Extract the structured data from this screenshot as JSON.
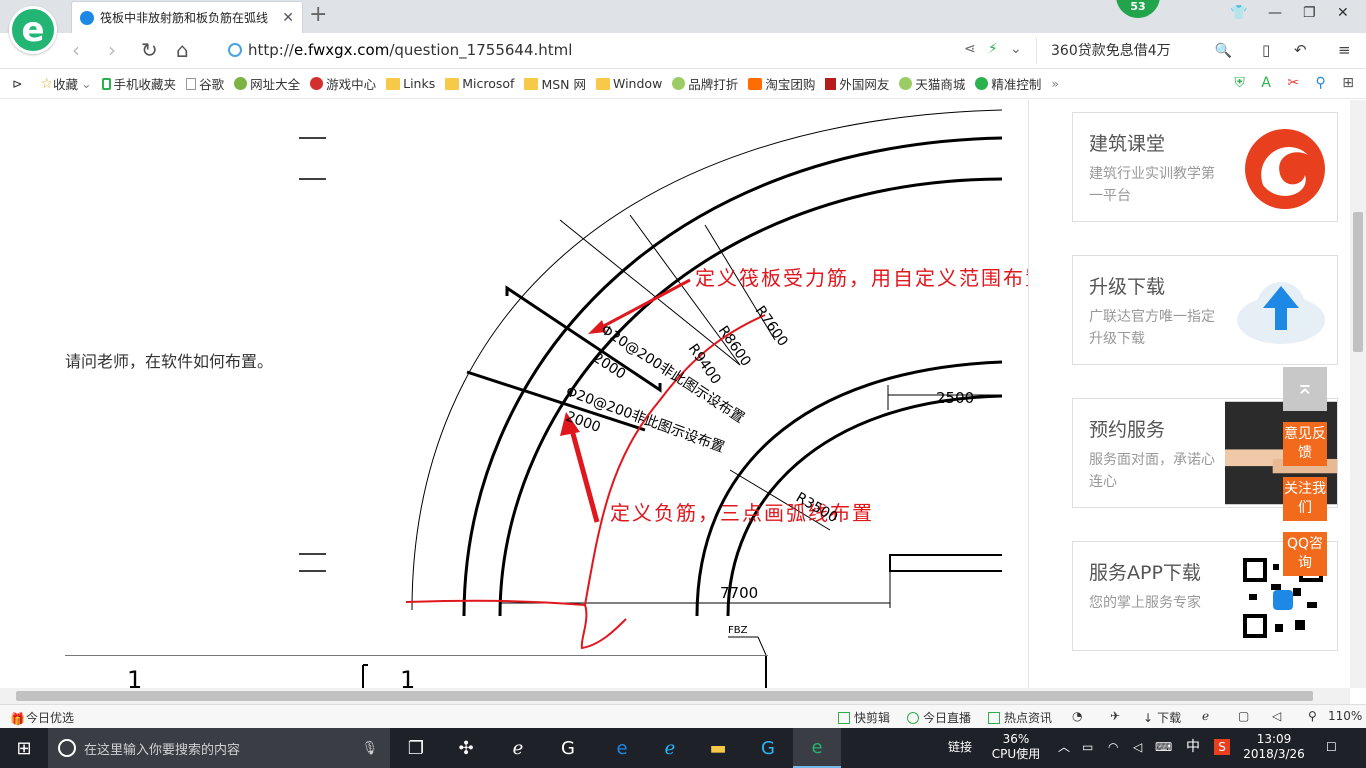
{
  "tab": {
    "title": "筏板中非放射筋和板负筋在弧线"
  },
  "notification_badge": "53",
  "address": {
    "scheme": "http://",
    "host": "e.fwxgx.com",
    "path": "/question_1755644.html"
  },
  "search": {
    "text": "360贷款免息借4万"
  },
  "bookmarks": [
    {
      "label": "收藏",
      "icon": "star-icon"
    },
    {
      "label": "手机收藏夹",
      "icon": "phone-icon"
    },
    {
      "label": "谷歌",
      "icon": "page-icon"
    },
    {
      "label": "网址大全",
      "icon": "globe-icon"
    },
    {
      "label": "游戏中心",
      "icon": "game-icon"
    },
    {
      "label": "Links",
      "icon": "folder-icon"
    },
    {
      "label": "Microsof",
      "icon": "folder-icon"
    },
    {
      "label": "MSN 网",
      "icon": "folder-icon"
    },
    {
      "label": "Window",
      "icon": "folder-icon"
    },
    {
      "label": "品牌打折",
      "icon": "leaf-icon"
    },
    {
      "label": "淘宝团购",
      "icon": "taobao-icon"
    },
    {
      "label": "外国网友",
      "icon": "flag-icon"
    },
    {
      "label": "天猫商城",
      "icon": "leaf-icon"
    },
    {
      "label": "精准控制",
      "icon": "chat-icon"
    }
  ],
  "question": {
    "text": "请问老师，在软件如何布置。"
  },
  "drawing": {
    "annotation_top": "定义筏板受力筋，用自定义范围布置",
    "annotation_bottom": "定义负筋，三点画弧线布置",
    "rebar_label_1": "Φ20@200非此图示设布置",
    "rebar_label_2": "Φ20@200非此图示设布置",
    "length_1": "2000",
    "length_2": "2000",
    "radius_1": "R7600",
    "radius_2": "R8600",
    "radius_3": "R9400",
    "radius_4": "R3500",
    "dim_right": "2500",
    "dim_bottom": "7700",
    "tag_fbz": "FBZ",
    "mark_1": "1",
    "mark_2": "1"
  },
  "sidebar": {
    "cards": [
      {
        "title": "建筑课堂",
        "desc": "建筑行业实训教学第一平台",
        "art": "logo-swirl-icon"
      },
      {
        "title": "升级下载",
        "desc": "广联达官方唯一指定升级下载",
        "art": "cloud-upload-icon"
      },
      {
        "title": "预约服务",
        "desc": "服务面对面，承诺心连心",
        "art": "handshake-icon"
      },
      {
        "title": "服务APP下载",
        "desc": "您的掌上服务专家",
        "art": "qr-code-icon"
      }
    ]
  },
  "float_buttons": [
    {
      "label": "意见反馈"
    },
    {
      "label": "关注我们"
    },
    {
      "label": "QQ咨询"
    }
  ],
  "statusbar": {
    "left": "今日优选",
    "items": [
      "快剪辑",
      "今日直播",
      "热点资讯",
      "下载"
    ],
    "zoom": "110%"
  },
  "taskbar": {
    "search_placeholder": "在这里输入你要搜索的内容",
    "tray_link": "链接",
    "cpu_percent": "36%",
    "cpu_label": "CPU使用",
    "ime": "中",
    "time": "13:09",
    "date": "2018/3/26"
  },
  "colors": {
    "accent_orange": "#f26b1d",
    "annotation_red": "#e0181e",
    "browser_green": "#22b573"
  }
}
